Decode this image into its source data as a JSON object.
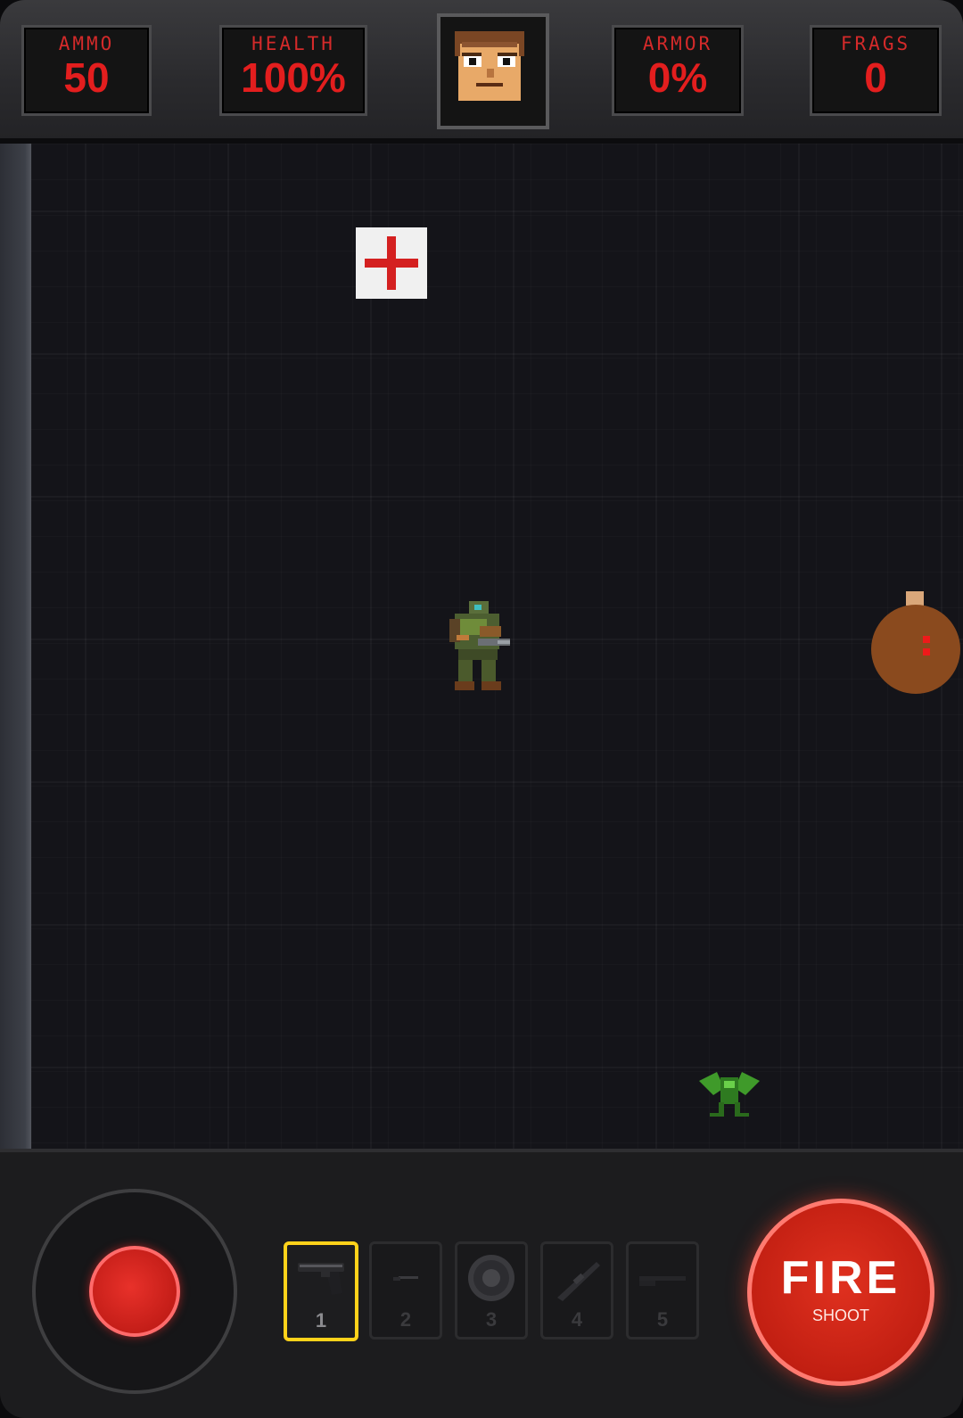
{
  "hud": {
    "ammo": {
      "label": "AMMO",
      "value": "50"
    },
    "health": {
      "label": "HEALTH",
      "value": "100%"
    },
    "armor": {
      "label": "ARMOR",
      "value": "0%"
    },
    "frags": {
      "label": "FRAGS",
      "value": "0"
    },
    "face_icon": "marine-face-icon"
  },
  "arena": {
    "pickups": [
      {
        "type": "medkit",
        "icon": "medkit-icon"
      }
    ],
    "player_icon": "doom-marine-sprite",
    "enemies": [
      {
        "type": "barrel-demon",
        "icon": "barrel-icon"
      },
      {
        "type": "imp",
        "icon": "green-imp-icon"
      }
    ]
  },
  "weapons": {
    "selected": "1",
    "slots": [
      {
        "num": "1",
        "icon": "pistol-icon"
      },
      {
        "num": "2",
        "icon": "knife-icon"
      },
      {
        "num": "3",
        "icon": "shield-icon"
      },
      {
        "num": "4",
        "icon": "rifle-icon"
      },
      {
        "num": "5",
        "icon": "shotgun-icon"
      }
    ]
  },
  "fire_button": {
    "label": "FIRE",
    "sublabel": "SHOOT"
  },
  "colors": {
    "hud_red": "#e31e1e",
    "selected_slot": "#ffd21a",
    "fire": "#c21f12"
  }
}
